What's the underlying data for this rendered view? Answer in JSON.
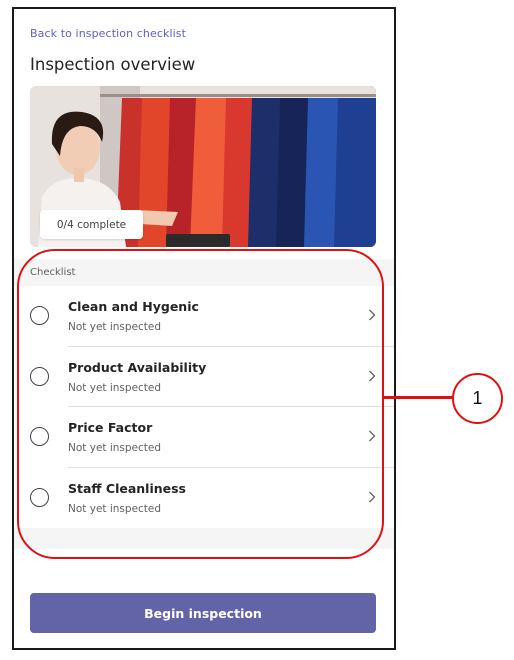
{
  "header": {
    "back_link": "Back to inspection checklist",
    "title": "Inspection overview"
  },
  "hero": {
    "progress_text": "0/4 complete"
  },
  "checklist": {
    "section_label": "Checklist",
    "items": [
      {
        "title": "Clean and Hygenic",
        "status": "Not yet inspected"
      },
      {
        "title": "Product Availability",
        "status": "Not yet inspected"
      },
      {
        "title": "Price Factor",
        "status": "Not yet inspected"
      },
      {
        "title": "Staff Cleanliness",
        "status": "Not yet inspected"
      }
    ]
  },
  "footer": {
    "primary_button": "Begin inspection"
  },
  "annotation": {
    "callout_number": "1"
  },
  "colors": {
    "brand": "#6264a7",
    "link": "#5b5fc7",
    "annotation": "#e01010"
  },
  "icons": {
    "item_status": "radio-unchecked-icon",
    "item_action": "chevron-right-icon"
  }
}
